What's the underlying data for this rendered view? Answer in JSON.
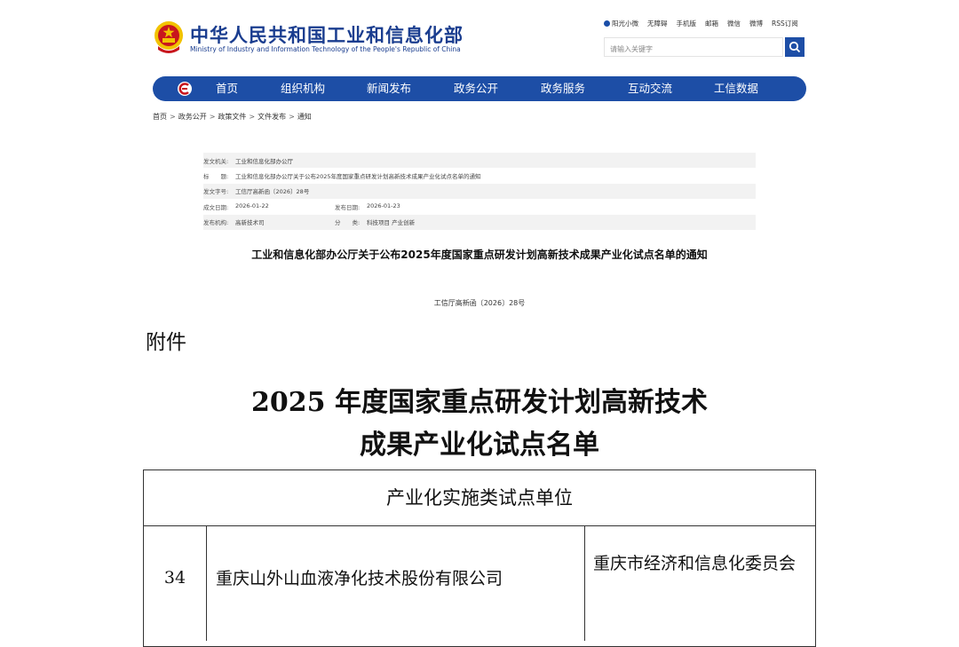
{
  "header": {
    "title": "中华人民共和国工业和信息化部",
    "subtitle": "Ministry of Industry and Information Technology of the People's Republic of China",
    "top_links": [
      "阳光小微",
      "无障碍",
      "手机版",
      "邮箱",
      "微信",
      "微博",
      "RSS订阅"
    ],
    "search_placeholder": "请输入关键字"
  },
  "nav": {
    "items": [
      "首页",
      "组织机构",
      "新闻发布",
      "政务公开",
      "政务服务",
      "互动交流",
      "工信数据"
    ]
  },
  "breadcrumb": [
    "首页",
    "政务公开",
    "政策文件",
    "文件发布",
    "通知"
  ],
  "breadcrumb_sep": ">",
  "doc_info": {
    "issuer_label": "发文机关:",
    "issuer": "工业和信息化部办公厅",
    "title_label": "标　　题:",
    "title": "工业和信息化部办公厅关于公布2025年度国家重点研发计划高新技术成果产业化试点名单的通知",
    "number_label": "发文字号:",
    "number": "工信厅高新函〔2026〕28号",
    "created_label": "成文日期:",
    "created": "2026-01-22",
    "published_label": "发布日期:",
    "published": "2026-01-23",
    "agency_label": "发布机构:",
    "agency": "高新技术司",
    "category_label": "分　　类:",
    "category": "科技项目 产业创新"
  },
  "doc_title": "工业和信息化部办公厅关于公布2025年度国家重点研发计划高新技术成果产业化试点名单的通知",
  "doc_number": "工信厅高新函〔2026〕28号",
  "attachment": {
    "label": "附件",
    "heading_line1": "2025 年度国家重点研发计划高新技术",
    "heading_line2": "成果产业化试点名单",
    "table_header": "产业化实施类试点单位",
    "row": {
      "number": "34",
      "company": "重庆山外山血液净化技术股份有限公司",
      "region": "重庆市经济和信息化委员会"
    }
  },
  "colors": {
    "brand_blue": "#1d4ea6",
    "title_blue": "#1a3d8f",
    "emblem_red": "#c8161d",
    "emblem_gold": "#f2c200"
  }
}
